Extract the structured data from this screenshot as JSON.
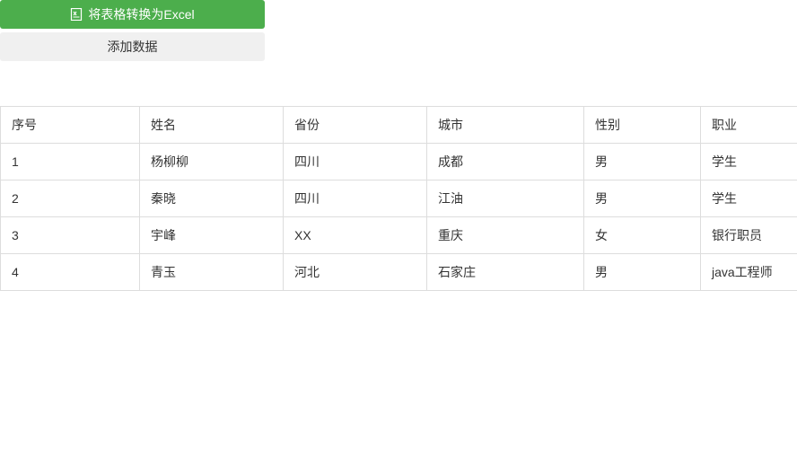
{
  "toolbar": {
    "export_label": "将表格转换为Excel",
    "add_label": "添加数据"
  },
  "table": {
    "headers": [
      "序号",
      "姓名",
      "省份",
      "城市",
      "性别",
      "职业"
    ],
    "rows": [
      [
        "1",
        "杨柳柳",
        "四川",
        "成都",
        "男",
        "学生"
      ],
      [
        "2",
        "秦晓",
        "四川",
        "江油",
        "男",
        "学生"
      ],
      [
        "3",
        "宇峰",
        "XX",
        "重庆",
        "女",
        "银行职员"
      ],
      [
        "4",
        "青玉",
        "河北",
        "石家庄",
        "男",
        "java工程师"
      ]
    ]
  }
}
